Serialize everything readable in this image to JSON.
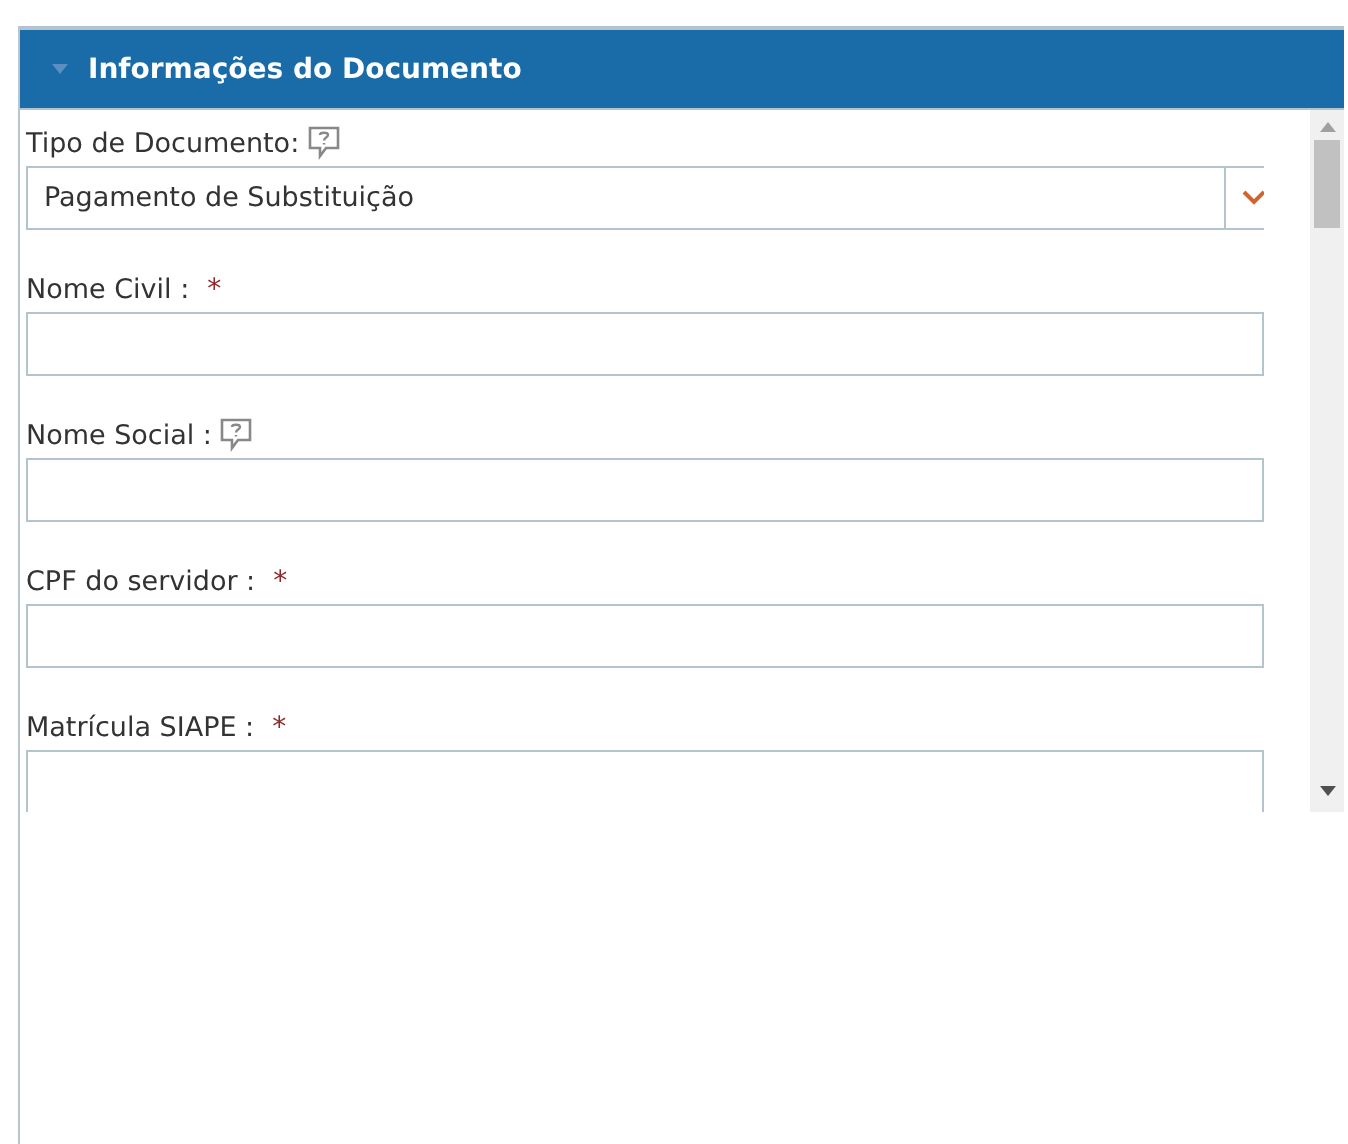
{
  "panel": {
    "title": "Informações do Documento",
    "expanded": true
  },
  "fields": [
    {
      "label": "Tipo de Documento:",
      "help": true,
      "required": false,
      "kind": "select",
      "value": "Pagamento de Substituição"
    },
    {
      "label": "Nome Civil :",
      "help": false,
      "required": true,
      "kind": "text"
    },
    {
      "label": "Nome Social :",
      "help": true,
      "required": false,
      "kind": "text"
    },
    {
      "label": "CPF do servidor :",
      "help": false,
      "required": true,
      "kind": "text"
    },
    {
      "label": "Matrícula SIAPE :",
      "help": false,
      "required": true,
      "kind": "text"
    }
  ],
  "required_mark": "*"
}
